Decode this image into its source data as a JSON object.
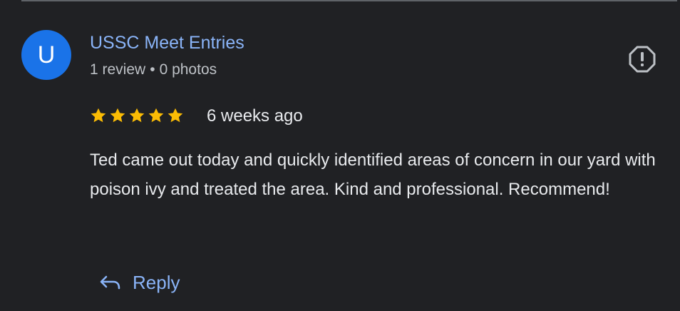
{
  "reviewer": {
    "initial": "U",
    "name": "USSC Meet Entries",
    "review_count": "1 review",
    "separator": "•",
    "photo_count": "0 photos",
    "avatar_color": "#1a73e8"
  },
  "review": {
    "rating": 5,
    "max_rating": 5,
    "date": "6 weeks ago",
    "text": "Ted came out today and quickly identified areas of concern in our yard with poison ivy and treated the area. Kind and professional. Recommend!"
  },
  "actions": {
    "reply_label": "Reply",
    "reply_icon": "reply-arrow-icon",
    "report_icon": "report-octagon-icon"
  },
  "colors": {
    "background": "#202124",
    "link": "#8ab4f8",
    "star": "#fbbc04",
    "text": "#e8eaed",
    "secondary_text": "#bdc1c6"
  }
}
